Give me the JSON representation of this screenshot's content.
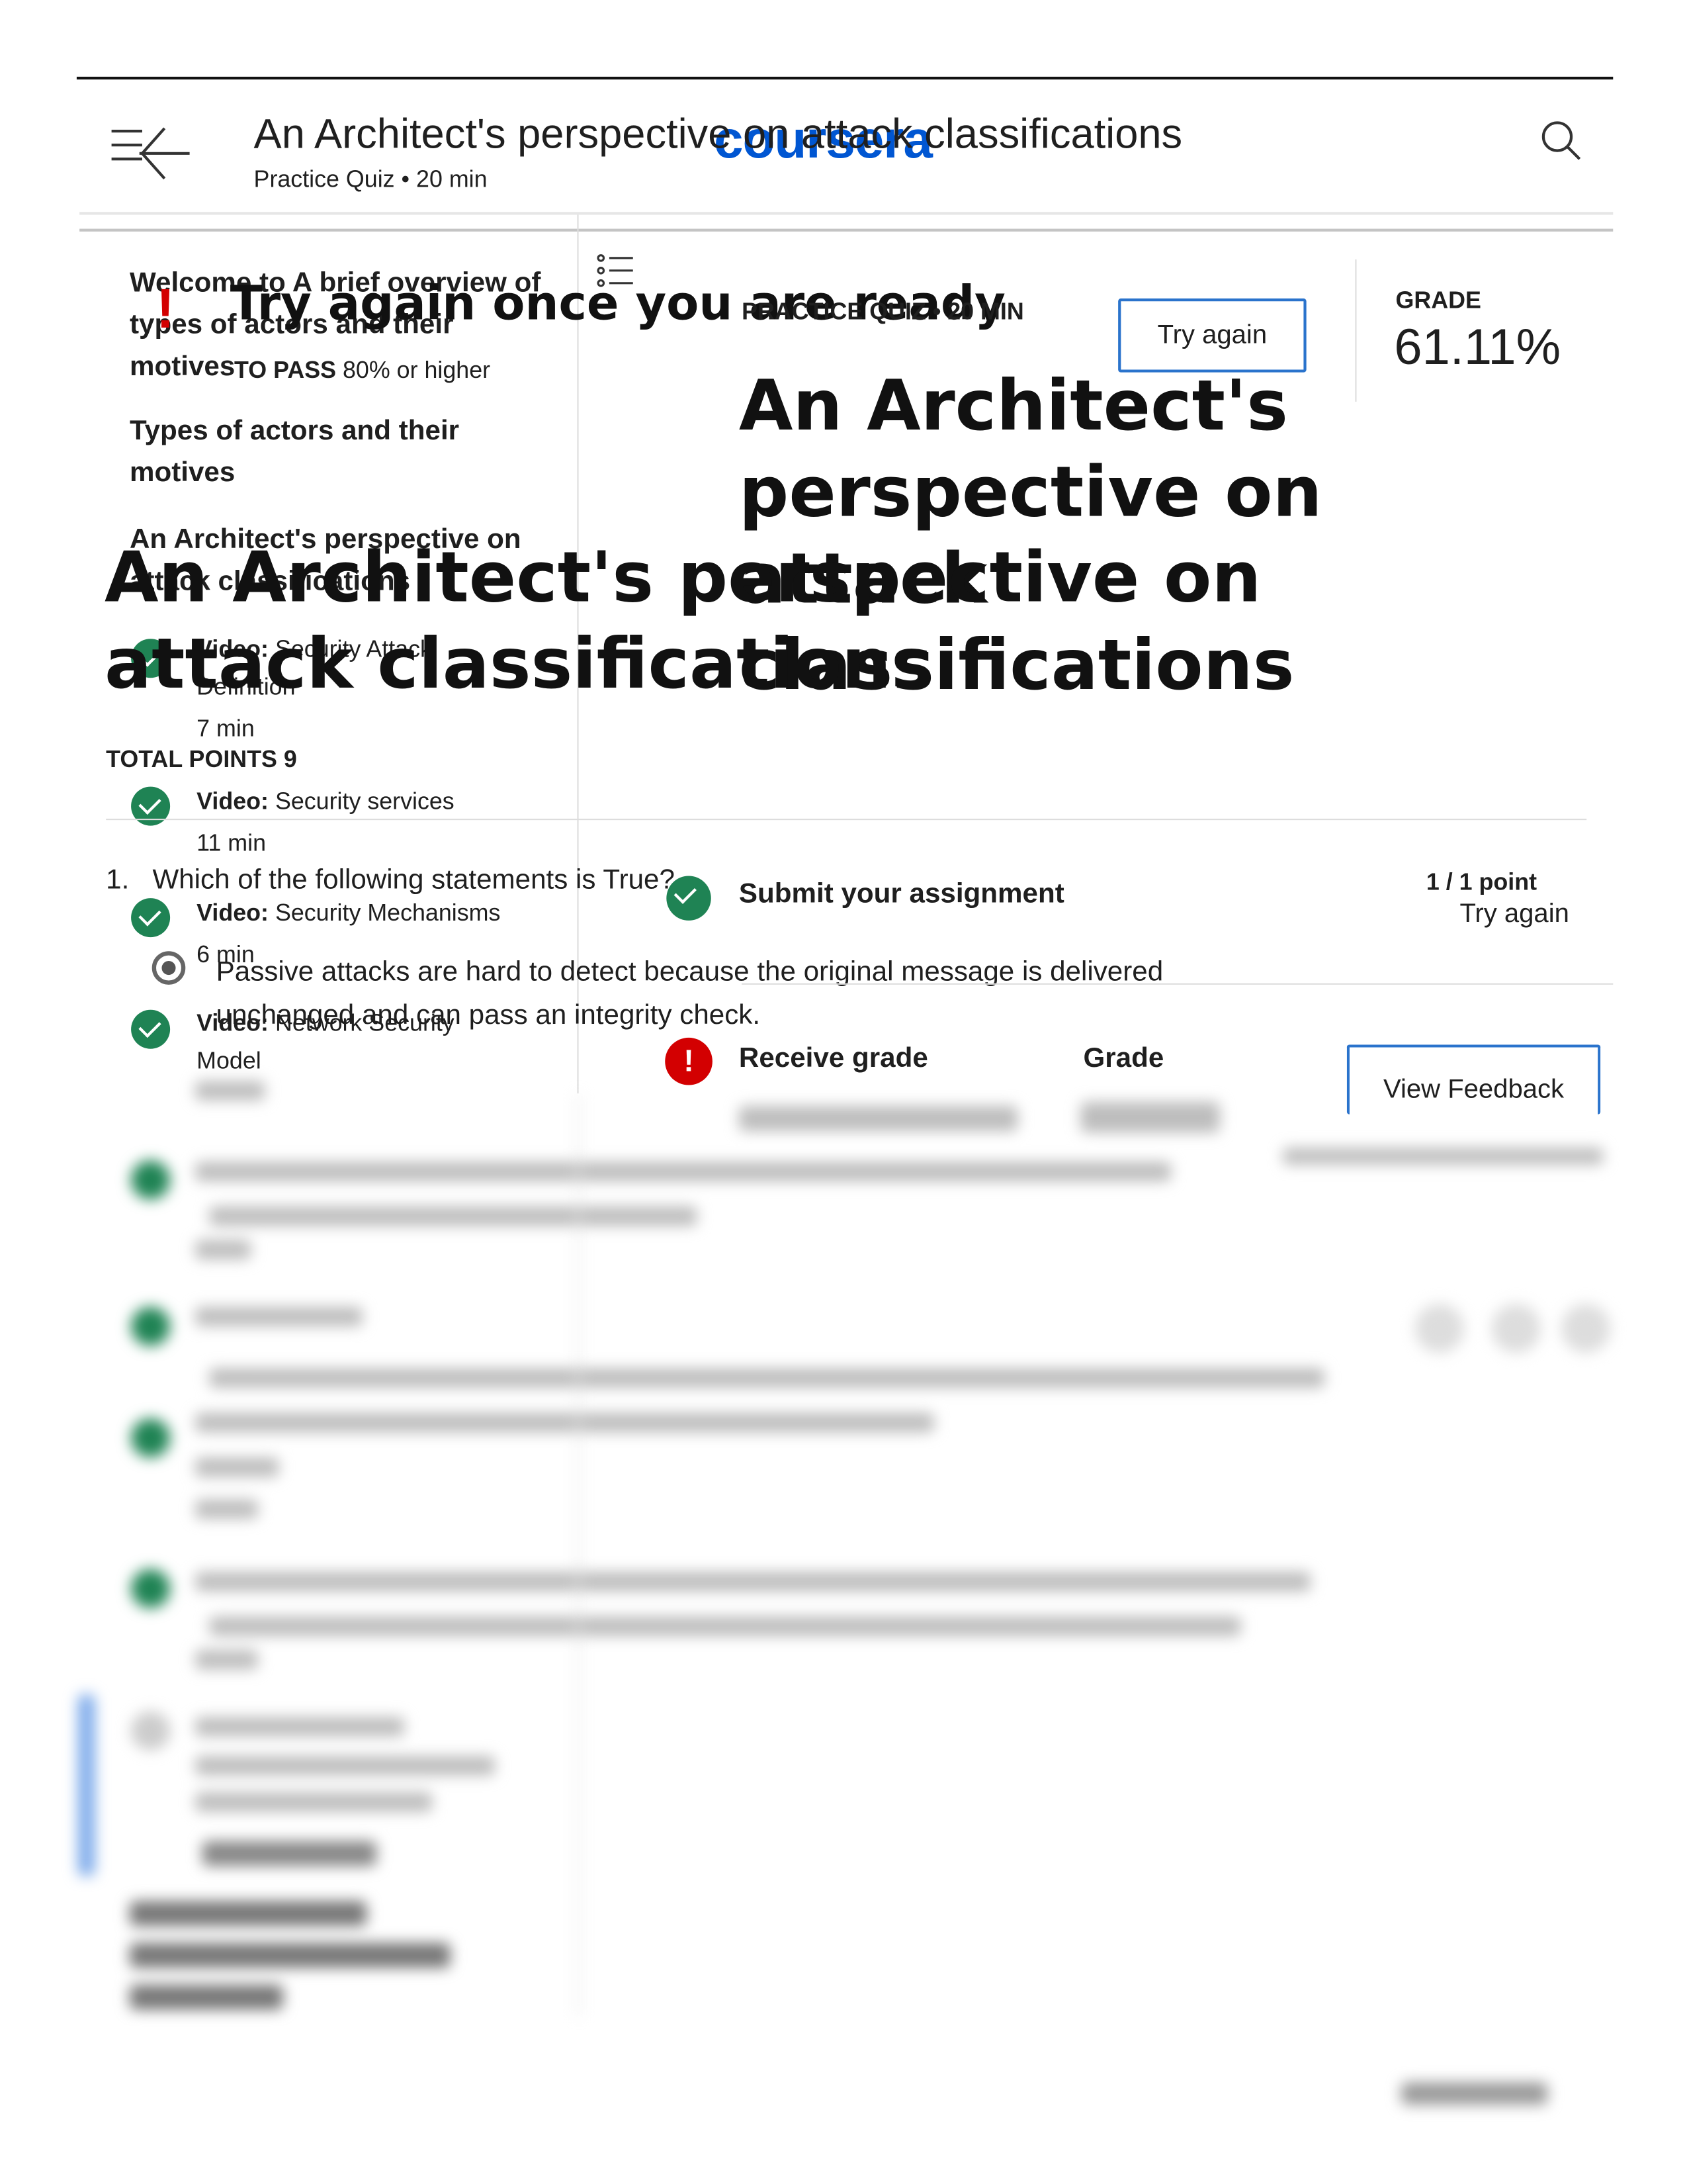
{
  "header": {
    "title": "An Architect's perspective on attack classifications",
    "subtitle": "Practice Quiz • 20 min",
    "logo": "coursera",
    "menu_icon": "menu-collapse-icon",
    "search_icon": "search-icon"
  },
  "sidebar": {
    "items": [
      {
        "label": "Welcome to A brief overview of types of actors and their motives"
      },
      {
        "label": "Types of actors and their motives"
      },
      {
        "label": "An Architect's perspective on attack classifications"
      },
      {
        "type": "Video:",
        "label": "Security Attack Definition",
        "duration": "7 min",
        "status": "completed"
      },
      {
        "type": "Video:",
        "label": "Security services",
        "duration": "11 min",
        "status": "completed"
      },
      {
        "type": "Video:",
        "label": "Security Mechanisms",
        "duration": "6 min",
        "status": "completed"
      },
      {
        "type": "Video:",
        "label": "Network Security Model",
        "status": "completed"
      }
    ]
  },
  "main": {
    "banner_title": "Try again once you are ready",
    "to_pass_label": "TO PASS",
    "to_pass_value": "80% or higher",
    "quiz_meta": "PRACTICE QUIZ • 20 MIN",
    "try_again_button": "Try again",
    "grade_label": "GRADE",
    "grade_value": "61.11%",
    "heading": "An Architect's perspective on attack classifications",
    "total_points": "TOTAL POINTS 9",
    "question": {
      "number": "1.",
      "text": "Which of the following statements is True?",
      "points": "1 / 1 point",
      "option": "Passive attacks are hard to detect because the original message is delivered unchanged and can pass an integrity check."
    },
    "steps": [
      {
        "label": "Submit your assignment",
        "action": "Try again",
        "status": "completed"
      },
      {
        "label": "Receive grade",
        "grade_label": "Grade",
        "action": "View Feedback",
        "status": "failed"
      }
    ]
  },
  "colors": {
    "brand": "#0056d2",
    "success": "#1f8354",
    "error": "#d30001",
    "button_border": "#2a73cc"
  }
}
